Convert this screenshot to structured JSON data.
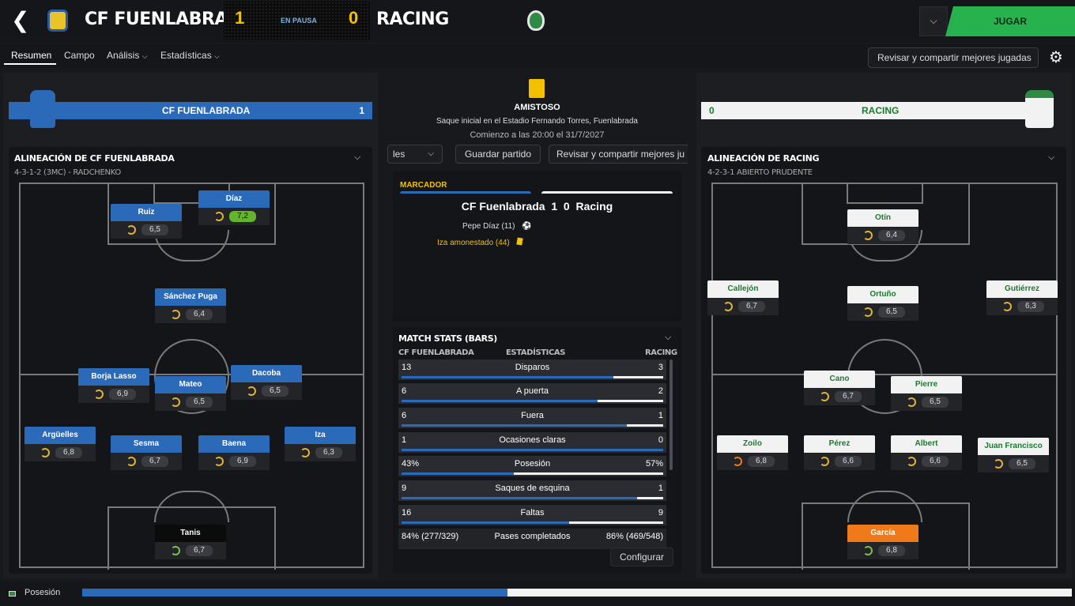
{
  "header": {
    "home_team": "CF FUENLABRADA",
    "home_score": "1",
    "status": "EN PAUSA",
    "away_score": "0",
    "away_team": "RACING",
    "play_label": "JUGAR"
  },
  "tabs": [
    {
      "label": "Resumen"
    },
    {
      "label": "Campo"
    },
    {
      "label": "Análisis"
    },
    {
      "label": "Estadísticas"
    }
  ],
  "review_label": "Revisar y compartir mejores jugadas",
  "home": {
    "banner_name": "CF FUENLABRADA",
    "banner_score": "1",
    "lineup_title": "ALINEACIÓN DE CF FUENLABRADA",
    "formation": "4-3-1-2 (3MC) - RADCHENKO",
    "players": [
      {
        "name": "Ruiz",
        "rating": "6,5"
      },
      {
        "name": "Díaz",
        "rating": "7,2"
      },
      {
        "name": "Sánchez Puga",
        "rating": "6,4"
      },
      {
        "name": "Borja Lasso",
        "rating": "6,9"
      },
      {
        "name": "Mateo",
        "rating": "6,5"
      },
      {
        "name": "Dacoba",
        "rating": "6,5"
      },
      {
        "name": "Argüelles",
        "rating": "6,8"
      },
      {
        "name": "Sesma",
        "rating": "6,7"
      },
      {
        "name": "Baena",
        "rating": "6,9"
      },
      {
        "name": "Iza",
        "rating": "6,3"
      },
      {
        "name": "Tanis",
        "rating": "6,7"
      }
    ]
  },
  "away": {
    "banner_name": "RACING",
    "banner_score": "0",
    "lineup_title": "ALINEACIÓN DE RACING",
    "formation": "4-2-3-1 ABIERTO PRUDENTE",
    "players": [
      {
        "name": "Otín",
        "rating": "6,4"
      },
      {
        "name": "Callejón",
        "rating": "6,7"
      },
      {
        "name": "Ortuño",
        "rating": "6,5"
      },
      {
        "name": "Gutiérrez",
        "rating": "6,3"
      },
      {
        "name": "Cano",
        "rating": "6,7"
      },
      {
        "name": "Pierre",
        "rating": "6,5"
      },
      {
        "name": "Zoilo",
        "rating": "6,8"
      },
      {
        "name": "Pérez",
        "rating": "6,6"
      },
      {
        "name": "Albert",
        "rating": "6,6"
      },
      {
        "name": "Juan Francisco",
        "rating": "6,5"
      },
      {
        "name": "García",
        "rating": "6,8"
      }
    ]
  },
  "match": {
    "competition": "AMISTOSO",
    "venue": "Saque inicial en el Estadio Fernando Torres, Fuenlabrada",
    "kickoff": "Comienzo a las 20:00 el 31/7/2027",
    "btn_partial": "les",
    "btn_save": "Guardar partido",
    "btn_review": "Revisar y compartir mejores ju"
  },
  "scoreboard": {
    "title": "MARCADOR",
    "line": "CF Fuenlabrada  1  0  Racing",
    "event1": "Pepe Díaz (11)",
    "event2": "Iza amonestado (44)"
  },
  "stats": {
    "title": "MATCH STATS (BARS)",
    "home_header": "CF FUENLABRADA",
    "mid_header": "ESTADÍSTICAS",
    "away_header": "RACING",
    "rows": [
      {
        "label": "Disparos",
        "home": "13",
        "away": "3",
        "home_share": 0.81
      },
      {
        "label": "A puerta",
        "home": "6",
        "away": "2",
        "home_share": 0.75
      },
      {
        "label": "Fuera",
        "home": "6",
        "away": "1",
        "home_share": 0.86
      },
      {
        "label": "Ocasiones claras",
        "home": "1",
        "away": "0",
        "home_share": 1.0
      },
      {
        "label": "Posesión",
        "home": "43%",
        "away": "57%",
        "home_share": 0.43
      },
      {
        "label": "Saques de esquina",
        "home": "9",
        "away": "1",
        "home_share": 0.9
      },
      {
        "label": "Faltas",
        "home": "16",
        "away": "9",
        "home_share": 0.64
      },
      {
        "label": "Pases completados",
        "home": "84% (277/329)",
        "away": "86% (469/548)",
        "home_share": null
      }
    ],
    "configure_label": "Configurar"
  },
  "footer": {
    "label": "Posesión",
    "home_share": 0.43
  },
  "colors": {
    "home": "#2a6ab8",
    "away": "#f2f2f2",
    "play": "#27b24e",
    "score": "#f2c200"
  }
}
